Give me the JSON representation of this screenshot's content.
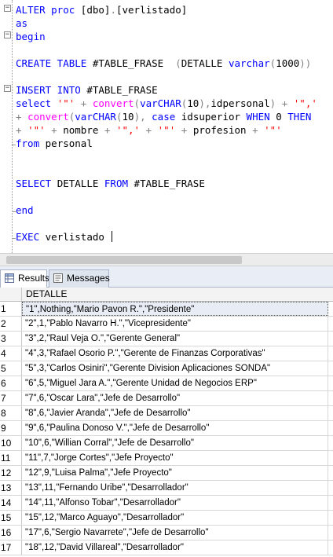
{
  "editor": {
    "lines": [
      [
        [
          "kw",
          "ALTER proc "
        ],
        [
          "",
          "[dbo]"
        ],
        [
          "gr",
          "."
        ],
        [
          "",
          "[verlistado]"
        ]
      ],
      [
        [
          "kw",
          "as"
        ]
      ],
      [
        [
          "kw",
          "begin"
        ]
      ],
      [],
      [
        [
          "kw",
          "CREATE TABLE "
        ],
        [
          "",
          "#TABLE_FRASE  "
        ],
        [
          "gr",
          "("
        ],
        [
          "",
          "DETALLE "
        ],
        [
          "kw",
          "varchar"
        ],
        [
          "gr",
          "("
        ],
        [
          "",
          "1000"
        ],
        [
          "gr",
          "))"
        ]
      ],
      [],
      [
        [
          "kw",
          "INSERT INTO "
        ],
        [
          "",
          "#TABLE_FRASE"
        ]
      ],
      [
        [
          "kw",
          "select "
        ],
        [
          "st",
          "'\"'"
        ],
        [
          "gr",
          " + "
        ],
        [
          "fn",
          "convert"
        ],
        [
          "gr",
          "("
        ],
        [
          "kw",
          "varCHAR"
        ],
        [
          "gr",
          "("
        ],
        [
          "",
          "10"
        ],
        [
          "gr",
          "),"
        ],
        [
          "",
          "idpersonal"
        ],
        [
          "gr",
          ") + "
        ],
        [
          "st",
          "'\",'"
        ]
      ],
      [
        [
          "gr",
          "+ "
        ],
        [
          "fn",
          "convert"
        ],
        [
          "gr",
          "("
        ],
        [
          "kw",
          "varCHAR"
        ],
        [
          "gr",
          "("
        ],
        [
          "",
          "10"
        ],
        [
          "gr",
          "), "
        ],
        [
          "kw",
          "case "
        ],
        [
          "",
          "idsuperior "
        ],
        [
          "kw",
          "WHEN "
        ],
        [
          "",
          "0 "
        ],
        [
          "kw",
          "THEN"
        ]
      ],
      [
        [
          "gr",
          "+ "
        ],
        [
          "st",
          "'\"'"
        ],
        [
          "gr",
          " + "
        ],
        [
          "",
          "nombre "
        ],
        [
          "gr",
          "+ "
        ],
        [
          "st",
          "'\",'"
        ],
        [
          "gr",
          " + "
        ],
        [
          "st",
          "'\"'"
        ],
        [
          "gr",
          " + "
        ],
        [
          "",
          "profesion "
        ],
        [
          "gr",
          "+ "
        ],
        [
          "st",
          "'\"'"
        ]
      ],
      [
        [
          "kw",
          "from "
        ],
        [
          "",
          "personal"
        ]
      ],
      [],
      [],
      [
        [
          "kw",
          "SELECT "
        ],
        [
          "",
          "DETALLE "
        ],
        [
          "kw",
          "FROM "
        ],
        [
          "",
          "#TABLE_FRASE"
        ]
      ],
      [],
      [
        [
          "kw",
          "end"
        ]
      ],
      [],
      [
        [
          "kw",
          "EXEC "
        ],
        [
          "",
          "verlistado "
        ]
      ]
    ]
  },
  "tabs": {
    "results": "Results",
    "messages": "Messages"
  },
  "grid": {
    "column": "DETALLE",
    "rows": [
      [
        "1",
        "\"1\",Nothing,\"Mario Pavon R.\",\"Presidente\""
      ],
      [
        "2",
        "\"2\",1,\"Pablo Navarro H.\",\"Vicepresidente\""
      ],
      [
        "3",
        "\"3\",2,\"Raul Veja O.\",\"Gerente General\""
      ],
      [
        "4",
        "\"4\",3,\"Rafael Osorio P.\",\"Gerente de Finanzas Corporativas\""
      ],
      [
        "5",
        "\"5\",3,\"Carlos Osiniri\",\"Gerente Division Aplicaciones SONDA\""
      ],
      [
        "6",
        "\"6\",5,\"Miguel Jara A.\",\"Gerente Unidad de Negocios ERP\""
      ],
      [
        "7",
        "\"7\",6,\"Oscar Lara\",\"Jefe de Desarrollo\""
      ],
      [
        "8",
        "\"8\",6,\"Javier Aranda\",\"Jefe de Desarrollo\""
      ],
      [
        "9",
        "\"9\",6,\"Paulina Donoso V.\",\"Jefe de Desarrollo\""
      ],
      [
        "10",
        "\"10\",6,\"Willian Corral\",\"Jefe de Desarrollo\""
      ],
      [
        "11",
        "\"11\",7,\"Jorge Cortes\",\"Jefe Proyecto\""
      ],
      [
        "12",
        "\"12\",9,\"Luisa Palma\",\"Jefe Proyecto\""
      ],
      [
        "13",
        "\"13\",11,\"Fernando Uribe\",\"Desarrollador\""
      ],
      [
        "14",
        "\"14\",11,\"Alfonso Tobar\",\"Desarrollador\""
      ],
      [
        "15",
        "\"15\",12,\"Marco Aguayo\",\"Desarrollador\""
      ],
      [
        "16",
        "\"17\",6,\"Sergio Navarrete\",\"Jefe de Desarrollo\""
      ],
      [
        "17",
        "\"18\",12,\"David Villareal\",\"Desarrollador\""
      ]
    ]
  }
}
